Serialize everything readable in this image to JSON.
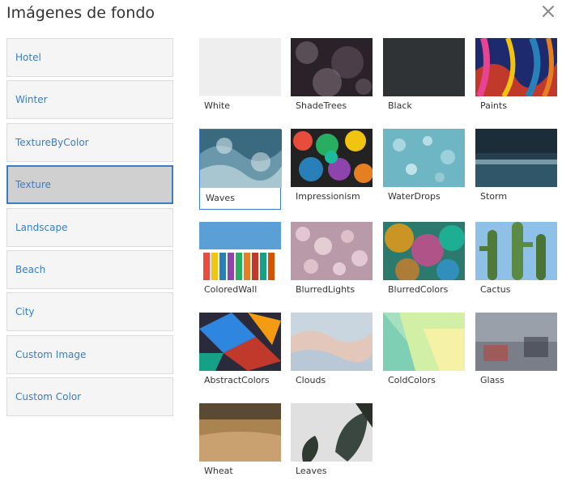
{
  "dialog": {
    "title": "Imágenes de fondo",
    "close_icon": "close-icon"
  },
  "categories": [
    {
      "label": "Hotel"
    },
    {
      "label": "Winter"
    },
    {
      "label": "TextureByColor"
    },
    {
      "label": "Texture",
      "active": true
    },
    {
      "label": "Landscape"
    },
    {
      "label": "Beach"
    },
    {
      "label": "City"
    },
    {
      "label": "Custom Image"
    },
    {
      "label": "Custom Color"
    }
  ],
  "images": [
    {
      "label": "White"
    },
    {
      "label": "ShadeTrees"
    },
    {
      "label": "Black"
    },
    {
      "label": "Paints"
    },
    {
      "label": "Waves",
      "selected": true
    },
    {
      "label": "Impressionism"
    },
    {
      "label": "WaterDrops"
    },
    {
      "label": "Storm"
    },
    {
      "label": "ColoredWall"
    },
    {
      "label": "BlurredLights"
    },
    {
      "label": "BlurredColors"
    },
    {
      "label": "Cactus"
    },
    {
      "label": "AbstractColors"
    },
    {
      "label": "Clouds"
    },
    {
      "label": "ColdColors"
    },
    {
      "label": "Glass"
    },
    {
      "label": "Wheat"
    },
    {
      "label": "Leaves"
    }
  ],
  "colors": {
    "accent": "#3a7dc4",
    "active_bg": "#d0d0d0"
  }
}
